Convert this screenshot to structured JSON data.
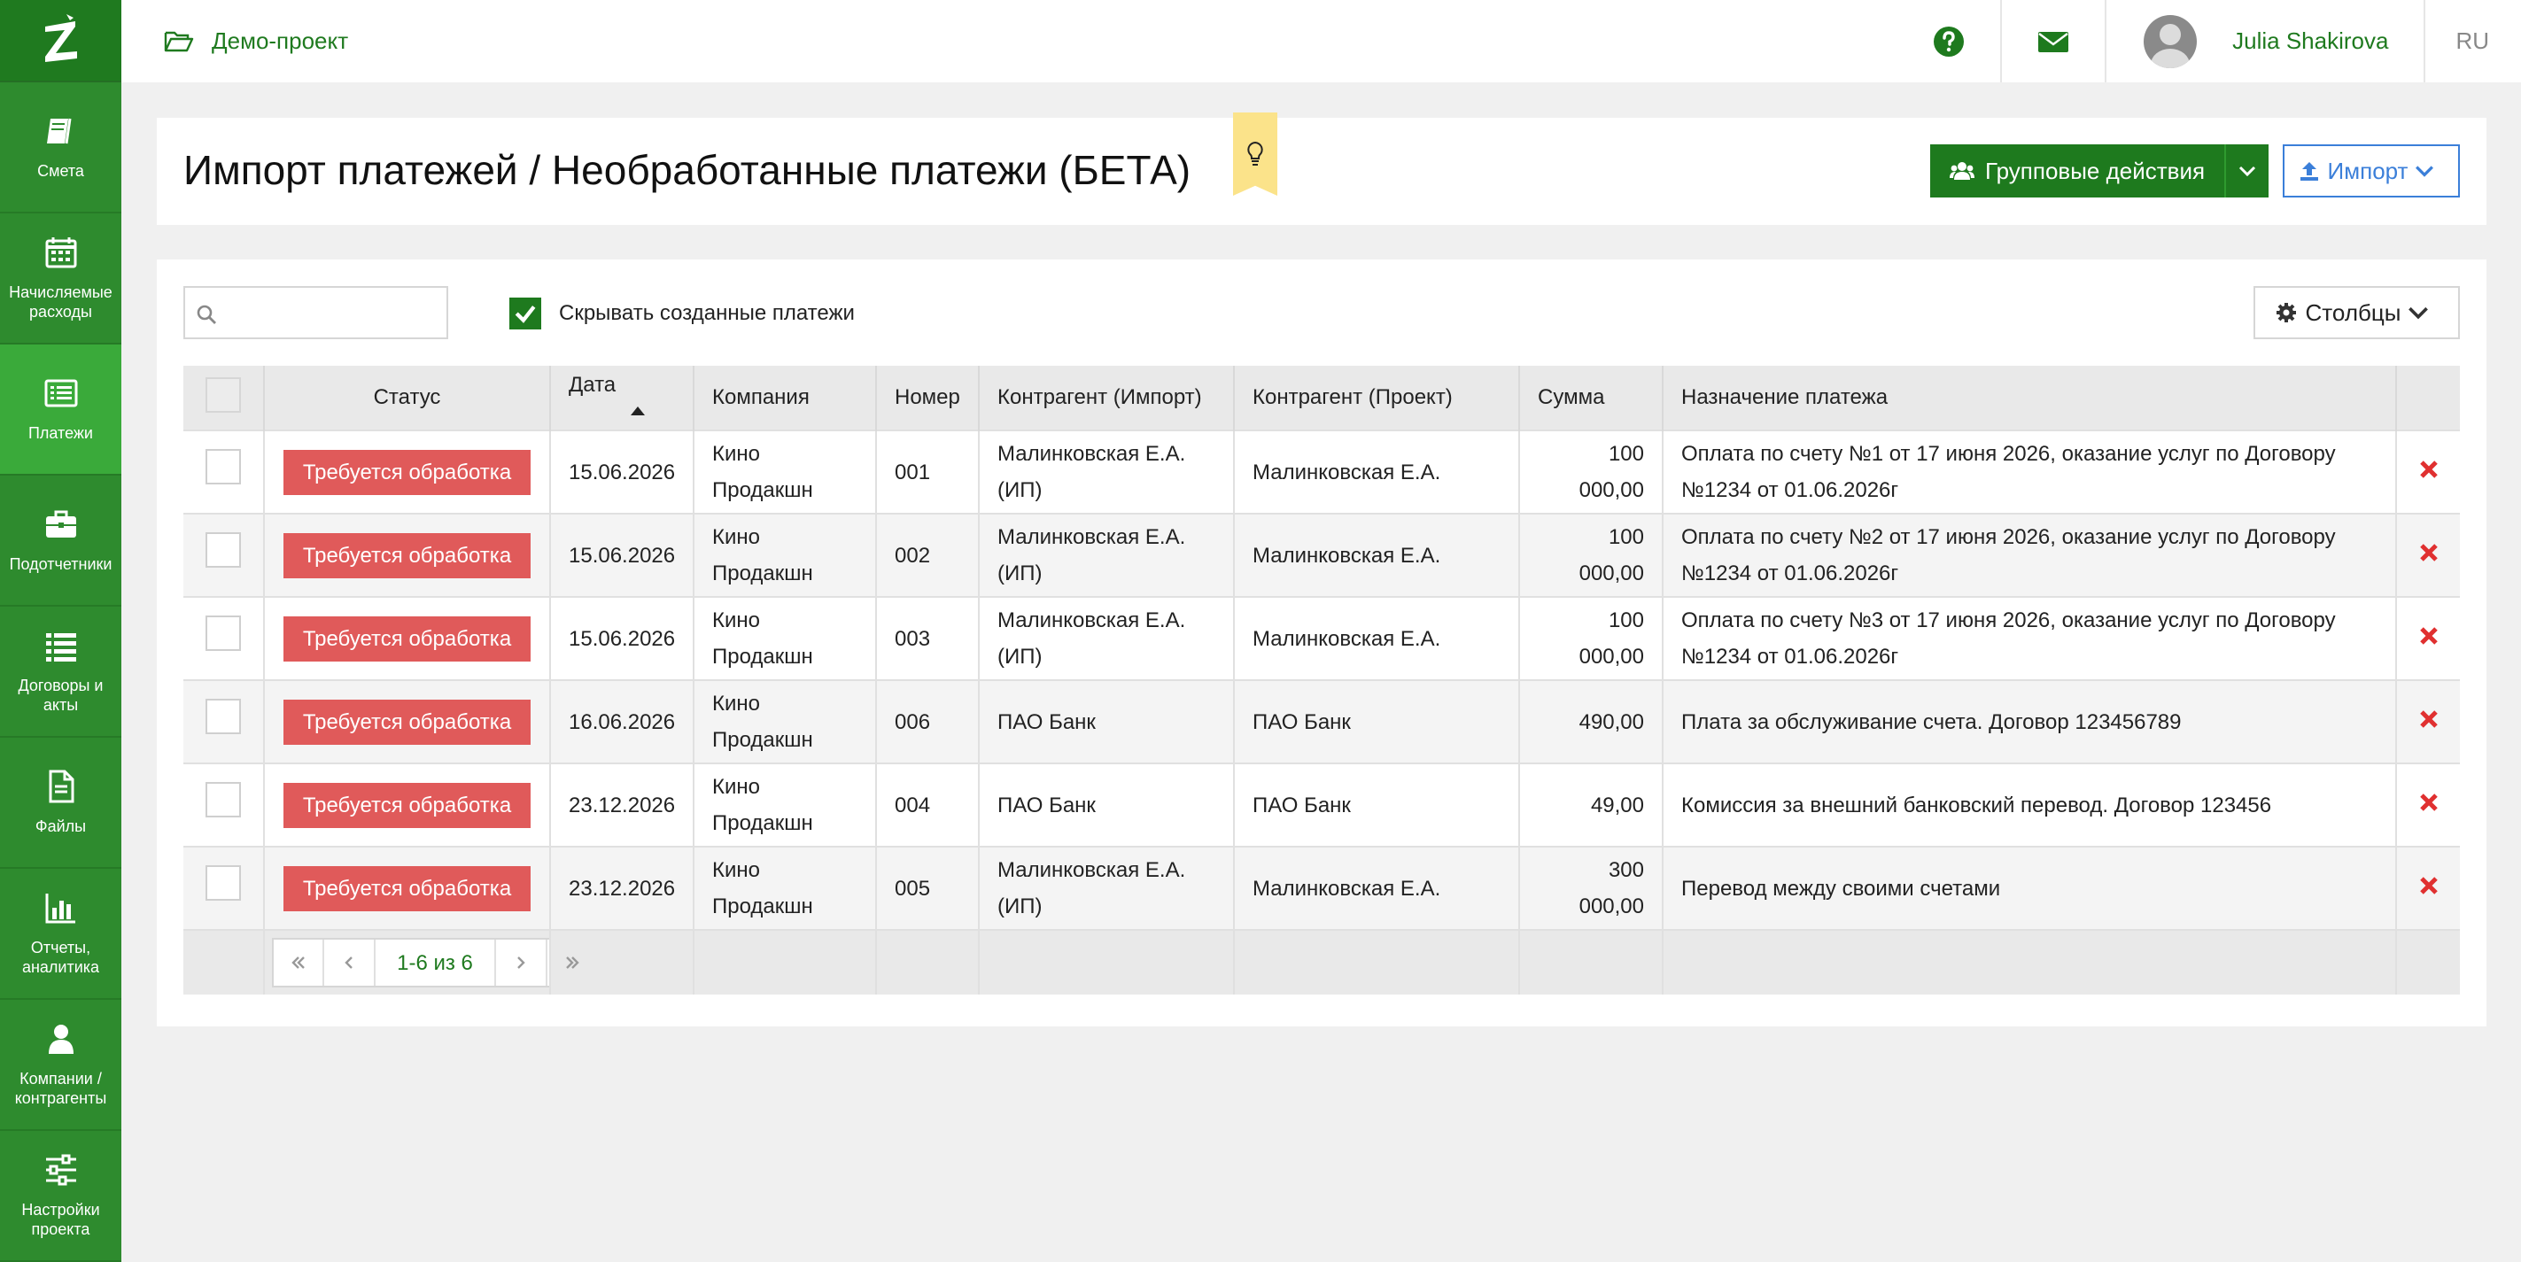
{
  "sidebar": {
    "items": [
      {
        "label": "Смета",
        "icon": "book-icon"
      },
      {
        "label": "Начисляемые\nрасходы",
        "icon": "calendar-icon"
      },
      {
        "label": "Платежи",
        "icon": "list-alt-icon"
      },
      {
        "label": "Подотчетники",
        "icon": "briefcase-icon"
      },
      {
        "label": "Договоры и\nакты",
        "icon": "list-icon"
      },
      {
        "label": "Файлы",
        "icon": "file-icon"
      },
      {
        "label": "Отчеты,\nаналитика",
        "icon": "bar-chart-icon"
      },
      {
        "label": "Компании /\nконтрагенты",
        "icon": "user-icon"
      },
      {
        "label": "Настройки\nпроекта",
        "icon": "sliders-icon"
      }
    ],
    "active_index": 2
  },
  "topbar": {
    "project_name": "Демо-проект",
    "user_name": "Julia Shakirova",
    "language": "RU"
  },
  "page": {
    "title": "Импорт платежей / Необработанные платежи (БЕТА)",
    "group_actions_label": "Групповые действия",
    "import_label": "Импорт"
  },
  "toolbar": {
    "search_placeholder": "",
    "hide_created_label": "Скрывать созданные платежи",
    "hide_created_checked": true,
    "columns_label": "Столбцы"
  },
  "table": {
    "headers": {
      "status": "Статус",
      "date": "Дата",
      "company": "Компания",
      "number": "Номер",
      "counterparty_import": "Контрагент (Импорт)",
      "counterparty_project": "Контрагент (Проект)",
      "amount": "Сумма",
      "purpose": "Назначение платежа"
    },
    "rows": [
      {
        "status": "Требуется обработка",
        "date": "15.06.2026",
        "company": "Кино Продакшн",
        "number": "001",
        "cp_import": "Малинковская Е.А. (ИП)",
        "cp_project": "Малинковская Е.А.",
        "amount": "100 000,00",
        "purpose": "Оплата по счету №1 от 17 июня 2026, оказание услуг по Договору №1234 от 01.06.2026г"
      },
      {
        "status": "Требуется обработка",
        "date": "15.06.2026",
        "company": "Кино Продакшн",
        "number": "002",
        "cp_import": "Малинковская Е.А. (ИП)",
        "cp_project": "Малинковская Е.А.",
        "amount": "100 000,00",
        "purpose": "Оплата по счету №2 от 17 июня 2026, оказание услуг по Договору №1234 от 01.06.2026г"
      },
      {
        "status": "Требуется обработка",
        "date": "15.06.2026",
        "company": "Кино Продакшн",
        "number": "003",
        "cp_import": "Малинковская Е.А. (ИП)",
        "cp_project": "Малинковская Е.А.",
        "amount": "100 000,00",
        "purpose": "Оплата по счету №3 от 17 июня 2026, оказание услуг по Договору №1234 от 01.06.2026г"
      },
      {
        "status": "Требуется обработка",
        "date": "16.06.2026",
        "company": "Кино Продакшн",
        "number": "006",
        "cp_import": "ПАО Банк",
        "cp_project": "ПАО Банк",
        "amount": "490,00",
        "purpose": "Плата за обслуживание счета. Договор 123456789"
      },
      {
        "status": "Требуется обработка",
        "date": "23.12.2026",
        "company": "Кино Продакшн",
        "number": "004",
        "cp_import": "ПАО Банк",
        "cp_project": "ПАО Банк",
        "amount": "49,00",
        "purpose": "Комиссия за внешний банковский перевод. Договор 123456"
      },
      {
        "status": "Требуется обработка",
        "date": "23.12.2026",
        "company": "Кино Продакшн",
        "number": "005",
        "cp_import": "Малинковская Е.А. (ИП)",
        "cp_project": "Малинковская Е.А.",
        "amount": "300 000,00",
        "purpose": "Перевод между своими счетами"
      }
    ],
    "pagination": "1-6 из 6"
  },
  "colors": {
    "sidebar": "#2e8b2e",
    "sidebar_active": "#3aaa3a",
    "primary_green": "#1e7a1e",
    "status_red": "#e05a5a",
    "import_blue": "#3b7fd9",
    "hint_yellow": "#fbe38a"
  }
}
